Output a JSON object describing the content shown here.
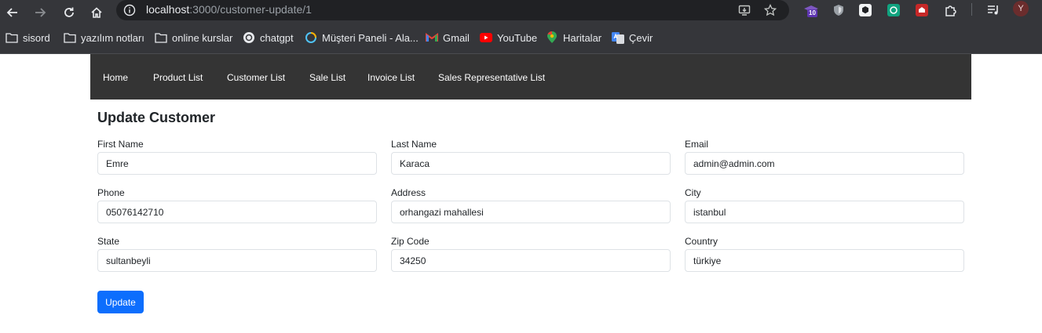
{
  "browser": {
    "url_host": "localhost",
    "url_path": ":3000/customer-update/1",
    "extension_badge": "10",
    "profile_initial": "Y"
  },
  "bookmarks": [
    {
      "label": "sisord",
      "icon": "folder-icon"
    },
    {
      "label": "yazılım notları",
      "icon": "folder-icon"
    },
    {
      "label": "online kurslar",
      "icon": "folder-icon"
    },
    {
      "label": "chatgpt",
      "icon": "chatgpt-icon"
    },
    {
      "label": "Müşteri Paneli - Ala...",
      "icon": "loading-icon"
    },
    {
      "label": "Gmail",
      "icon": "gmail-icon"
    },
    {
      "label": "YouTube",
      "icon": "youtube-icon"
    },
    {
      "label": "Haritalar",
      "icon": "maps-icon"
    },
    {
      "label": "Çevir",
      "icon": "translate-icon"
    }
  ],
  "nav": {
    "items": [
      "Home",
      "Product List",
      "Customer List",
      "Sale List",
      "Invoice List",
      "Sales Representative List"
    ]
  },
  "form": {
    "title": "Update Customer",
    "fields": [
      {
        "label": "First Name",
        "value": "Emre"
      },
      {
        "label": "Last Name",
        "value": "Karaca"
      },
      {
        "label": "Email",
        "value": "admin@admin.com"
      },
      {
        "label": "Phone",
        "value": "05076142710"
      },
      {
        "label": "Address",
        "value": "orhangazi mahallesi"
      },
      {
        "label": "City",
        "value": "istanbul"
      },
      {
        "label": "State",
        "value": "sultanbeyli"
      },
      {
        "label": "Zip Code",
        "value": "34250"
      },
      {
        "label": "Country",
        "value": "türkiye"
      }
    ],
    "submit_label": "Update"
  },
  "colors": {
    "navbar_bg": "#343434",
    "primary_button": "#0d6efd",
    "browser_chrome": "#35363a"
  }
}
